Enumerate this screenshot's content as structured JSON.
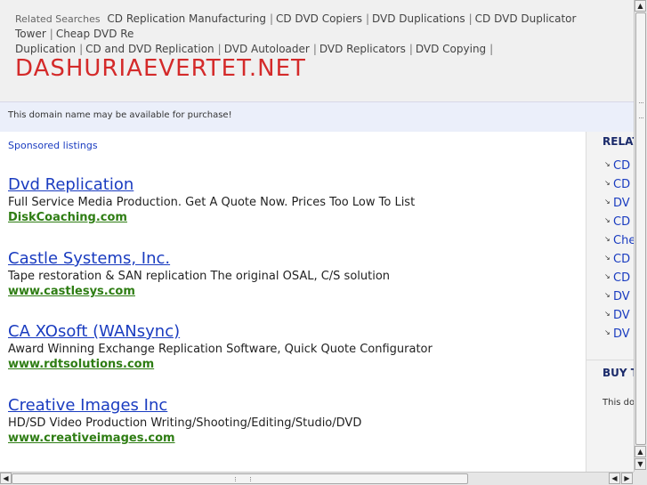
{
  "related_bar": {
    "label": "Related Searches",
    "items": [
      "CD Replication Manufacturing",
      "CD DVD Copiers",
      "DVD Duplications",
      "CD DVD Duplicator Tower",
      "Cheap DVD Re",
      "Duplication",
      "CD and DVD Replication",
      "DVD Autoloader",
      "DVD Replicators",
      "DVD Copying"
    ]
  },
  "site_title": "DASHURIAEVERTET.NET",
  "notice": "This domain name may be available for purchase!",
  "sponsored_label": "Sponsored listings",
  "ads": [
    {
      "title": "Dvd Replication",
      "desc": "Full Service Media Production. Get A Quote Now. Prices Too Low To List",
      "url": "DiskCoaching.com"
    },
    {
      "title": "Castle Systems, Inc.",
      "desc": "Tape restoration & SAN replication The original OSAL, C/S solution",
      "url": "www.castlesys.com"
    },
    {
      "title": "CA XOsoft (WANsync)",
      "desc": "Award Winning Exchange Replication Software, Quick Quote Configurator",
      "url": "www.rdtsolutions.com"
    },
    {
      "title": "Creative Images Inc",
      "desc": "HD/SD Video Production Writing/Shooting/Editing/Studio/DVD",
      "url": "www.creativeimages.com"
    }
  ],
  "right_column": {
    "heading": "RELAT",
    "items": [
      "CD",
      "CD",
      "DV",
      "CD",
      "Che",
      "CD",
      "CD",
      "DV",
      "DV",
      "DV"
    ],
    "buy_heading": "BUY T",
    "buy_text": "This dor"
  },
  "colors": {
    "title_red": "#d42a2a",
    "link_blue": "#1a3cc0",
    "url_green": "#2e7d13",
    "notice_bg": "#ebeffa"
  }
}
